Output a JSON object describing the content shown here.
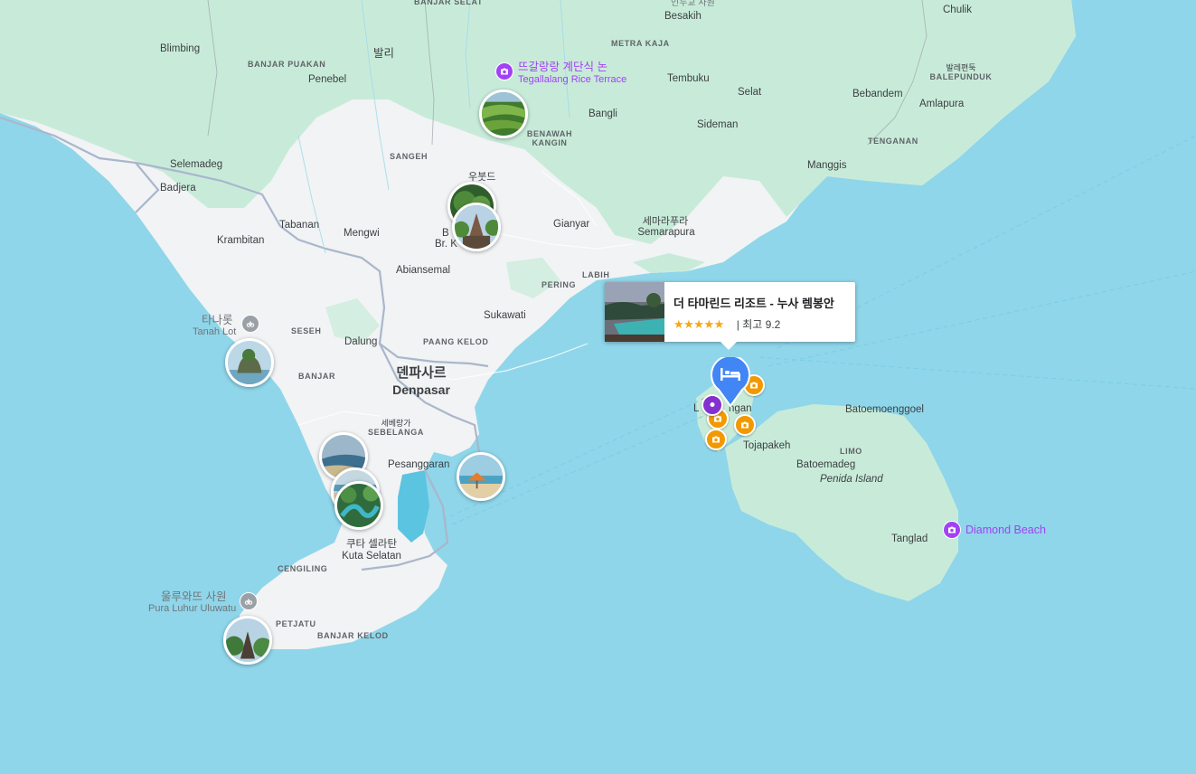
{
  "map": {
    "water_color": "#8fd6ea",
    "land_color": "#f1f3f4",
    "vegetation_color": "#c8ebd9",
    "road_color": "#aab6cc"
  },
  "labels": {
    "besakih": "Besakih",
    "besakih_ko": "인두교 사원",
    "banjar_selat": "BANJAR SELAT",
    "chulik": "Chulik",
    "blimbing": "Blimbing",
    "bali_ko": "발리",
    "banjar_puakan": "BANJAR PUAKAN",
    "metra_kaja": "METRA KAJA",
    "balepunduk_ko": "발레편둑",
    "balepunduk": "BALEPUNDUK",
    "penebel": "Penebel",
    "tembuku": "Tembuku",
    "selat": "Selat",
    "bebandem": "Bebandem",
    "amlapura": "Amlapura",
    "bangli": "Bangli",
    "benawah_kangin": "BENAWAH KANGIN",
    "sideman": "Sideman",
    "tenganan": "TENGANAN",
    "sangeh": "SANGEH",
    "selemadeg": "Selemadeg",
    "badjera": "Badjera",
    "manggis": "Manggis",
    "ubud_partial": "우붓드",
    "tabanan": "Tabanan",
    "mengwi": "Mengwi",
    "gianyar": "Gianyar",
    "semarapura_ko": "세마라푸라",
    "semarapura": "Semarapura",
    "krambitan": "Krambitan",
    "br_k_partial": "Br. K",
    "b_partial": "B",
    "abiansemal": "Abiansemal",
    "labih": "LABIH",
    "pering": "PERING",
    "sukawati": "Sukawati",
    "seseh": "SESEH",
    "dalung": "Dalung",
    "paang_kelod": "PAANG KELOD",
    "denpasar_ko": "덴파사르",
    "denpasar": "Denpasar",
    "banjar": "BANJAR",
    "sebelanga_ko": "세베랑가",
    "sebelanga": "SEBELANGA",
    "pesanggaran": "Pesanggaran",
    "kuta_selatan_ko": "쿠타 셀라탄",
    "kuta_selatan": "Kuta Selatan",
    "cengiling": "CENGILING",
    "petjatu": "PETJATU",
    "banjar_kelod": "BANJAR KELOD",
    "lembongan_partial": "L",
    "lembongan_partial2": "ngan",
    "tojapakeh": "Tojapakeh",
    "batoemoenggoel": "Batoemoenggoel",
    "limo": "LIMO",
    "batoemadeg": "Batoemadeg",
    "penida_island": "Penida Island",
    "tanglad": "Tanglad"
  },
  "pois": {
    "tegallalang_ko": "뜨갈랑랑 계단식 논",
    "tegallalang": "Tegallalang Rice Terrace",
    "tanah_lot_ko": "타나롯",
    "tanah_lot": "Tanah Lot",
    "uluwatu_ko": "울루와뜨 사원",
    "uluwatu": "Pura Luhur Uluwatu",
    "diamond_beach": "Diamond Beach"
  },
  "hotel_card": {
    "name": "더 타마린드 리조트 - 누사 렘봉안",
    "stars": "★★★★★",
    "rating_text": "| 최고 9.2"
  }
}
